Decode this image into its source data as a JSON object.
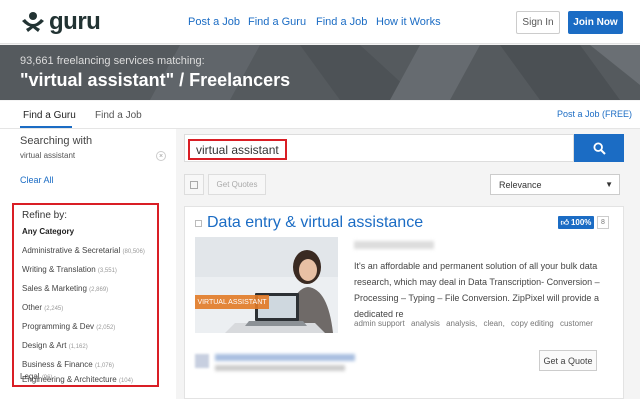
{
  "brand": {
    "name": "guru",
    "accent": "#1b6cc4",
    "highlight": "#d91e25"
  },
  "nav": {
    "items": [
      "Post a Job",
      "Find a Guru",
      "Find a Job",
      "How it Works"
    ],
    "sign_in": "Sign In",
    "join": "Join Now"
  },
  "banner": {
    "count_text": "93,661 freelancing services matching:",
    "title": "\"virtual assistant\" / Freelancers"
  },
  "tabs": {
    "items": [
      "Find a Guru",
      "Find a Job"
    ],
    "active": "Find a Guru",
    "post_free": "Post a Job (FREE)"
  },
  "sidebar": {
    "searching_label": "Searching with",
    "search_term": "virtual assistant",
    "clear_all": "Clear All",
    "refine_title": "Refine by:",
    "categories": [
      {
        "label": "Any Category",
        "count": ""
      },
      {
        "label": "Administrative & Secretarial",
        "count": "(80,506)"
      },
      {
        "label": "Writing & Translation",
        "count": "(3,551)"
      },
      {
        "label": "Sales & Marketing",
        "count": "(2,869)"
      },
      {
        "label": "Other",
        "count": "(2,245)"
      },
      {
        "label": "Programming & Dev",
        "count": "(2,052)"
      },
      {
        "label": "Design & Art",
        "count": "(1,162)"
      },
      {
        "label": "Business & Finance",
        "count": "(1,076)"
      },
      {
        "label": "Engineering & Architecture",
        "count": "(104)"
      },
      {
        "label": "Legal",
        "count": "(96)"
      }
    ]
  },
  "search": {
    "value": "virtual assistant"
  },
  "toolbar": {
    "get_quotes": "Get Quotes",
    "sort": "Relevance"
  },
  "result": {
    "title": "Data entry & virtual assistance",
    "rating": "100%",
    "rating_count": "8",
    "thumb_tag": "VIRTUAL ASSISTANT",
    "description": "It's an affordable and permanent solution of all your bulk data research, which may deal in Data Transcription- Conversion – Processing – Typing – File Conversion. ZipPixel will provide a dedicated re",
    "skills": [
      "admin support",
      "analysis",
      "analysis,",
      "clean,",
      "copy editing",
      "customer"
    ],
    "quote_button": "Get a Quote"
  }
}
